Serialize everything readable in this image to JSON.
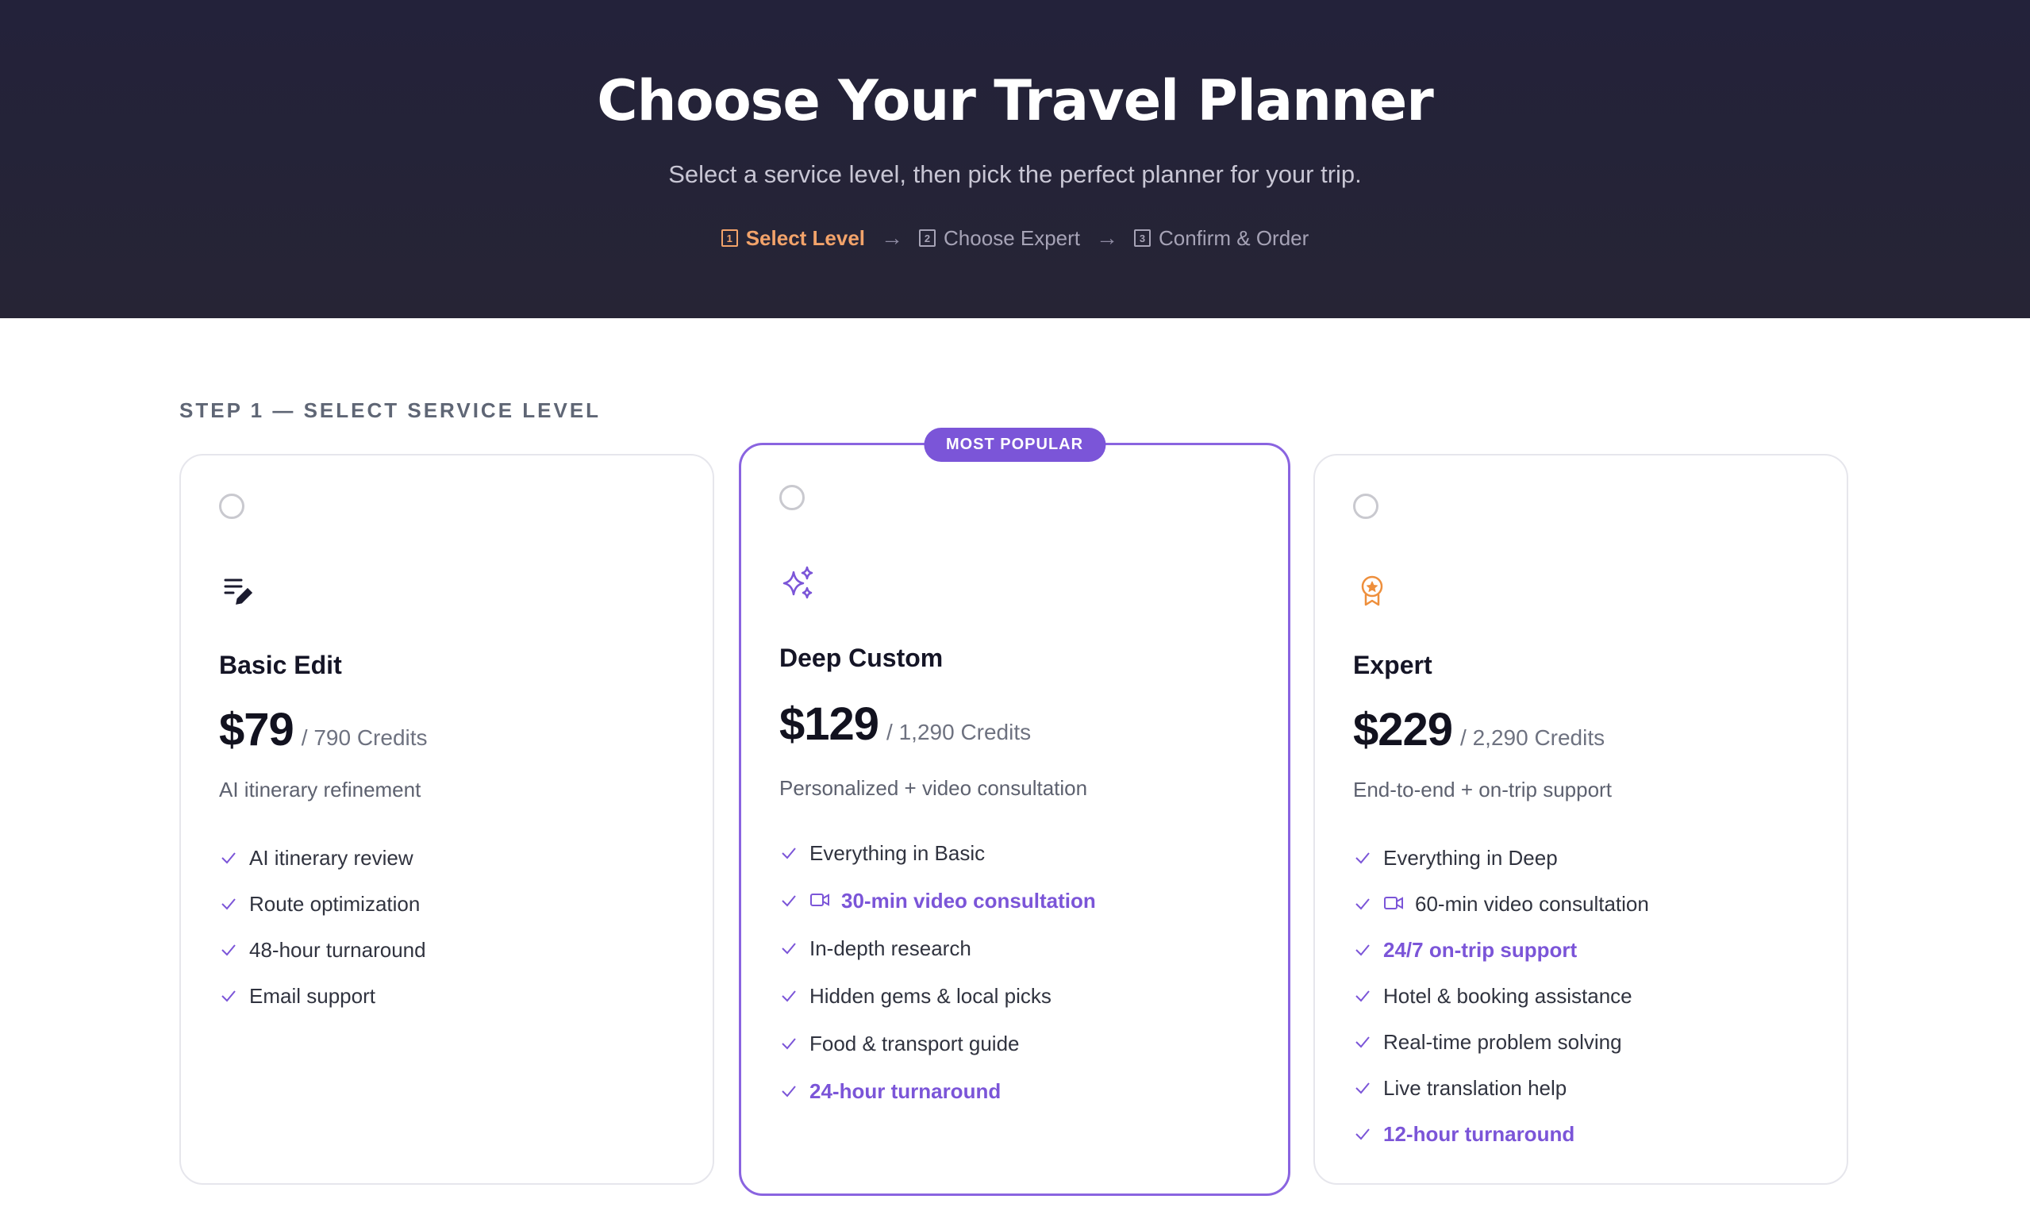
{
  "header": {
    "title": "Choose Your Travel Planner",
    "subtitle": "Select a service level, then pick the perfect planner for your trip.",
    "steps": [
      {
        "num": "1",
        "label": "Select Level"
      },
      {
        "num": "2",
        "label": "Choose Expert"
      },
      {
        "num": "3",
        "label": "Confirm & Order"
      }
    ],
    "arrow": "→"
  },
  "section_label": "STEP 1 — SELECT SERVICE LEVEL",
  "plans": [
    {
      "title": "Basic Edit",
      "price": "$79",
      "credits": "/ 790 Credits",
      "tagline": "AI itinerary refinement",
      "icon": "edit-list-icon",
      "features": [
        "AI itinerary review",
        "Route optimization",
        "48-hour turnaround",
        "Email support"
      ]
    },
    {
      "badge": "MOST POPULAR",
      "title": "Deep Custom",
      "price": "$129",
      "credits": "/ 1,290 Credits",
      "tagline": "Personalized + video consultation",
      "icon": "sparkles-icon",
      "features": [
        "Everything in Basic",
        "30-min video consultation",
        "In-depth research",
        "Hidden gems & local picks",
        "Food & transport guide",
        "24-hour turnaround"
      ]
    },
    {
      "title": "Expert",
      "price": "$229",
      "credits": "/ 2,290 Credits",
      "tagline": "End-to-end + on-trip support",
      "icon": "award-icon",
      "features": [
        "Everything in Deep",
        "60-min video consultation",
        "24/7 on-trip support",
        "Hotel & booking assistance",
        "Real-time problem solving",
        "Live translation help",
        "12-hour turnaround"
      ]
    }
  ],
  "colors": {
    "accent": "#7b55d8",
    "active_step": "#f2a36a",
    "hero_bg": "#23223a"
  }
}
